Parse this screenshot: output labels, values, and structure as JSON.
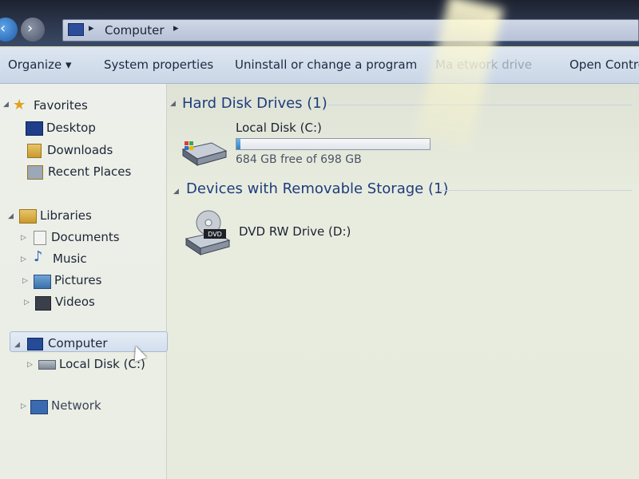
{
  "address": {
    "crumb": "Computer"
  },
  "toolbar": {
    "organize": "Organize ▾",
    "system_properties": "System properties",
    "uninstall": "Uninstall or change a program",
    "map_network": "Ma etwork drive",
    "open_control": "Open Contro"
  },
  "sidebar": {
    "favorites": "Favorites",
    "desktop": "Desktop",
    "downloads": "Downloads",
    "recent": "Recent Places",
    "libraries": "Libraries",
    "documents": "Documents",
    "music": "Music",
    "pictures": "Pictures",
    "videos": "Videos",
    "computer": "Computer",
    "local_disk": "Local Disk (C:)",
    "network": "Network"
  },
  "content": {
    "hdd_group": "Hard Disk Drives (1)",
    "removable_group": "Devices with Removable Storage (1)",
    "local_disk_label": "Local Disk (C:)",
    "local_disk_free": "684 GB free of 698 GB",
    "local_disk_used_fraction": 0.02,
    "dvd_label": "DVD RW Drive (D:)",
    "dvd_badge": "DVD"
  }
}
